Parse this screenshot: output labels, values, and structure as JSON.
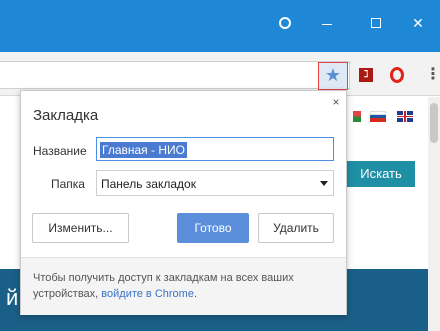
{
  "titlebar": {
    "buttons": [
      "profile-icon",
      "minimize-icon",
      "maximize-icon",
      "close-icon"
    ],
    "close_glyph": "✕",
    "color": "#1e88d6"
  },
  "toolbar": {
    "star_glyph": "★",
    "menu_glyph": "⋮",
    "extensions": [
      "pdf-extension-icon",
      "opera-extension-icon"
    ],
    "pdf_glyph": "ℷ"
  },
  "page": {
    "search_button": "Искать",
    "banner_char": "й",
    "accent": "#1f8fa6"
  },
  "bookmark_popup": {
    "title": "Закладка",
    "close_glyph": "×",
    "name_label": "Название",
    "name_value": "Главная - НИО",
    "folder_label": "Папка",
    "folder_value": "Панель закладок",
    "edit_button": "Изменить...",
    "done_button": "Готово",
    "remove_button": "Удалить",
    "footer_text": "Чтобы получить доступ к закладкам на всех ваших устройствах,",
    "footer_link": "войдите в Chrome",
    "footer_end": ".",
    "done_color": "#5b8fdc"
  }
}
